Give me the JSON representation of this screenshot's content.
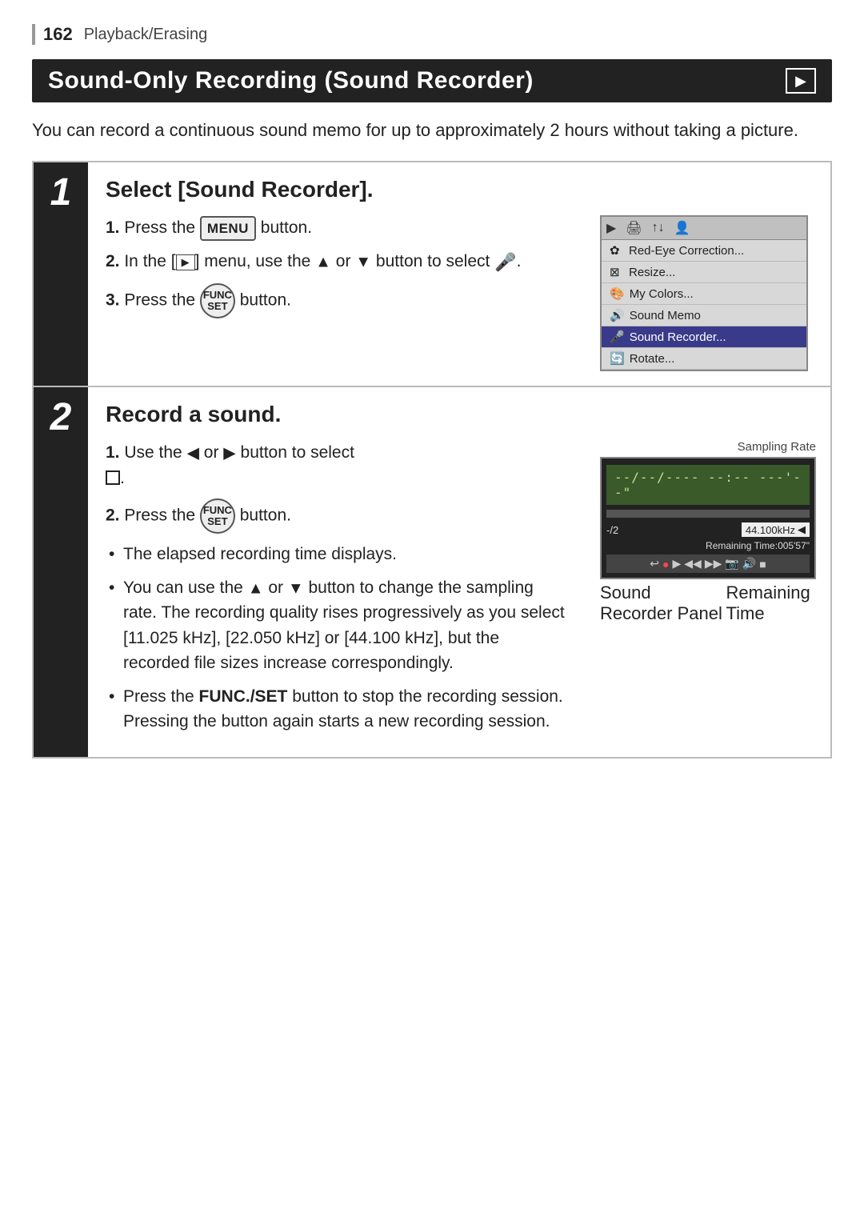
{
  "page": {
    "number": "162",
    "section": "Playback/Erasing",
    "title": "Sound-Only Recording (Sound Recorder)",
    "playback_icon": "▶",
    "intro": "You can record a continuous sound memo for up to approximately 2 hours without taking a picture."
  },
  "steps": [
    {
      "number": "1",
      "heading": "Select [Sound Recorder].",
      "items": [
        {
          "num": "1.",
          "text": "Press the",
          "has_menu_btn": true,
          "btn_label": "MENU",
          "suffix": " button."
        },
        {
          "num": "2.",
          "text": "In the [",
          "has_playback_icon": true,
          "middle": "] menu, use the ▲ or ▼ button to select",
          "has_sound_icon": true,
          "suffix": " ."
        },
        {
          "num": "3.",
          "text": "Press the",
          "has_func_btn": true,
          "btn_label": "FUNC\nSET",
          "suffix": " button."
        }
      ],
      "menu": {
        "topbar_icons": [
          "▶",
          "🖨",
          "↑↓",
          "👤"
        ],
        "items": [
          {
            "icon": "✿",
            "label": "Red-Eye Correction...",
            "selected": false
          },
          {
            "icon": "⊠",
            "label": "Resize...",
            "selected": false
          },
          {
            "icon": "🎨",
            "label": "My Colors...",
            "selected": false
          },
          {
            "icon": "🔊",
            "label": "Sound Memo",
            "selected": false
          },
          {
            "icon": "🎤",
            "label": "Sound Recorder...",
            "selected": true
          },
          {
            "icon": "🔄",
            "label": "Rotate...",
            "selected": false
          }
        ]
      }
    },
    {
      "number": "2",
      "heading": "Record a sound.",
      "sampling_rate_label": "Sampling Rate",
      "display_text": "--/--/---- --:-- ---'--\"",
      "minus2": "-/2",
      "khz_value": "44.100kHz",
      "remaining_label": "Remaining Time:005'57\"",
      "controls": [
        "↩",
        "⏺",
        "▶",
        "⏮",
        "⏭",
        "📷",
        "○",
        "■"
      ],
      "panel_label": "Sound Recorder Panel",
      "remaining_time_label": "Remaining Time",
      "items": [
        {
          "num": "1.",
          "text": "Use the ◀ or ▶ button to select □."
        },
        {
          "num": "2.",
          "text": "Press the FUNC/SET button."
        }
      ],
      "bullets": [
        "The elapsed recording time displays.",
        "You can use the ▲ or ▼ button to change the sampling rate. The recording quality rises progressively as you select [11.025 kHz], [22.050 kHz] or [44.100 kHz], but the recorded file sizes increase correspondingly.",
        "Press the FUNC./SET button to stop the recording session. Pressing the button again starts a new recording session."
      ]
    }
  ]
}
